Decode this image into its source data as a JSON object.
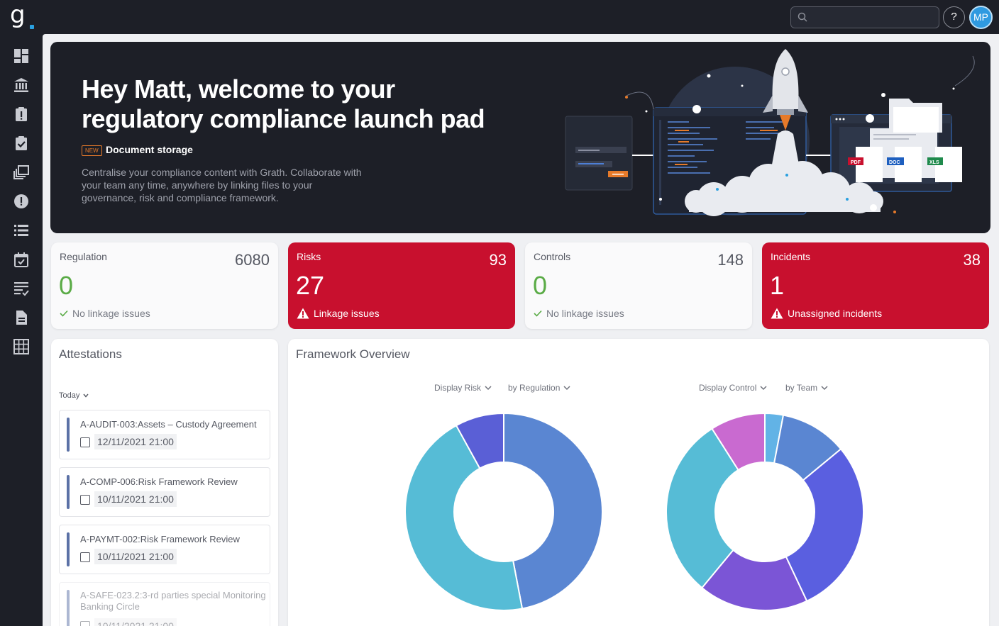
{
  "topbar": {
    "logo_text": "g",
    "search_placeholder": "",
    "help_label": "?",
    "avatar_initials": "MP"
  },
  "sidebar": {
    "items": [
      {
        "name": "dashboard-icon"
      },
      {
        "name": "regulation-icon"
      },
      {
        "name": "risks-icon"
      },
      {
        "name": "controls-icon"
      },
      {
        "name": "documents-icon"
      },
      {
        "name": "incidents-icon"
      },
      {
        "name": "list-icon"
      },
      {
        "name": "calendar-icon"
      },
      {
        "name": "checklist-icon"
      },
      {
        "name": "file-icon"
      },
      {
        "name": "grid-icon"
      }
    ]
  },
  "banner": {
    "title_line1": "Hey Matt, welcome to your",
    "title_line2": "regulatory compliance launch pad",
    "badge": "NEW",
    "feature": "Document storage",
    "description": "Centralise your compliance content with Grath. Collaborate with your team any time, anywhere by linking files to your governance, risk and compliance framework.",
    "file_tags": [
      "PDF",
      "DOC",
      "XLS"
    ]
  },
  "stats": [
    {
      "label": "Regulation",
      "total": "6080",
      "value": "0",
      "footer": "No linkage issues",
      "style": "light"
    },
    {
      "label": "Risks",
      "total": "93",
      "value": "27",
      "footer": "Linkage issues",
      "style": "red"
    },
    {
      "label": "Controls",
      "total": "148",
      "value": "0",
      "footer": "No linkage issues",
      "style": "light"
    },
    {
      "label": "Incidents",
      "total": "38",
      "value": "1",
      "footer": "Unassigned incidents",
      "style": "red"
    }
  ],
  "attestations": {
    "title": "Attestations",
    "filter": "Today",
    "items": [
      {
        "name": "A-AUDIT-003:Assets – Custody Agreement",
        "date": "12/11/2021 21:00"
      },
      {
        "name": "A-COMP-006:Risk Framework Review",
        "date": "10/11/2021 21:00"
      },
      {
        "name": "A-PAYMT-002:Risk Framework Review",
        "date": "10/11/2021 21:00"
      },
      {
        "name": "A-SAFE-023.2:3-rd parties special Monitoring Banking Circle",
        "date": "10/11/2021 21:00"
      }
    ]
  },
  "framework": {
    "title": "Framework Overview",
    "left_display": "Display Risk",
    "left_group": "by Regulation",
    "right_display": "Display Control",
    "right_group": "by Team"
  },
  "colors": {
    "red": "#c8102e",
    "green": "#5aab46",
    "dark": "#1d1f27"
  },
  "chart_data": [
    {
      "type": "pie",
      "donut": true,
      "values": [
        47,
        45,
        8
      ],
      "colors": [
        "#5a86d2",
        "#56bcd6",
        "#5a5fd6"
      ]
    },
    {
      "type": "pie",
      "donut": true,
      "values": [
        3,
        11,
        29,
        18,
        30,
        9
      ],
      "colors": [
        "#62b3e6",
        "#5a86d2",
        "#5a5fe0",
        "#7b55d6",
        "#56bcd6",
        "#c96ad0"
      ]
    }
  ]
}
